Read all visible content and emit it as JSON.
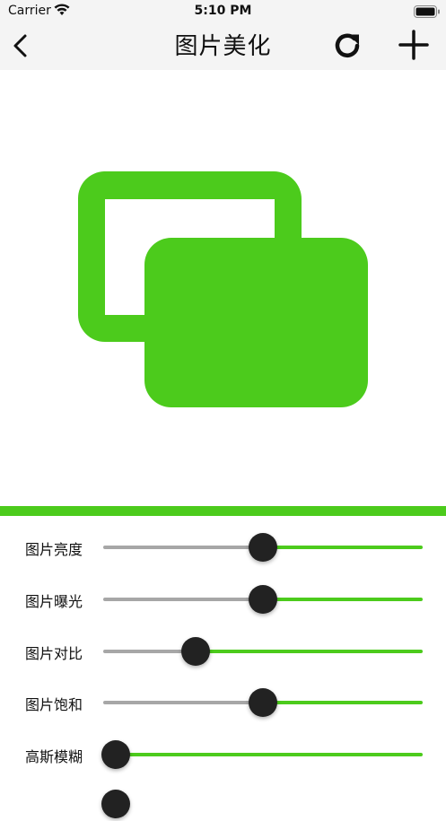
{
  "status_bar": {
    "carrier": "Carrier",
    "time": "5:10 PM"
  },
  "nav": {
    "title": "图片美化",
    "back_icon": "chevron-left-icon",
    "refresh_icon": "refresh-icon",
    "add_icon": "plus-icon"
  },
  "preview": {
    "icon": "copy-icon",
    "icon_color": "#4ccb1c"
  },
  "colors": {
    "accent": "#4ccb1c",
    "track": "#a7a7a7",
    "thumb": "#222222"
  },
  "sliders": [
    {
      "label": "图片亮度",
      "value": 0.5
    },
    {
      "label": "图片曝光",
      "value": 0.5
    },
    {
      "label": "图片对比",
      "value": 0.27
    },
    {
      "label": "图片饱和",
      "value": 0.5
    },
    {
      "label": "高斯模糊",
      "value": 0.0
    }
  ]
}
